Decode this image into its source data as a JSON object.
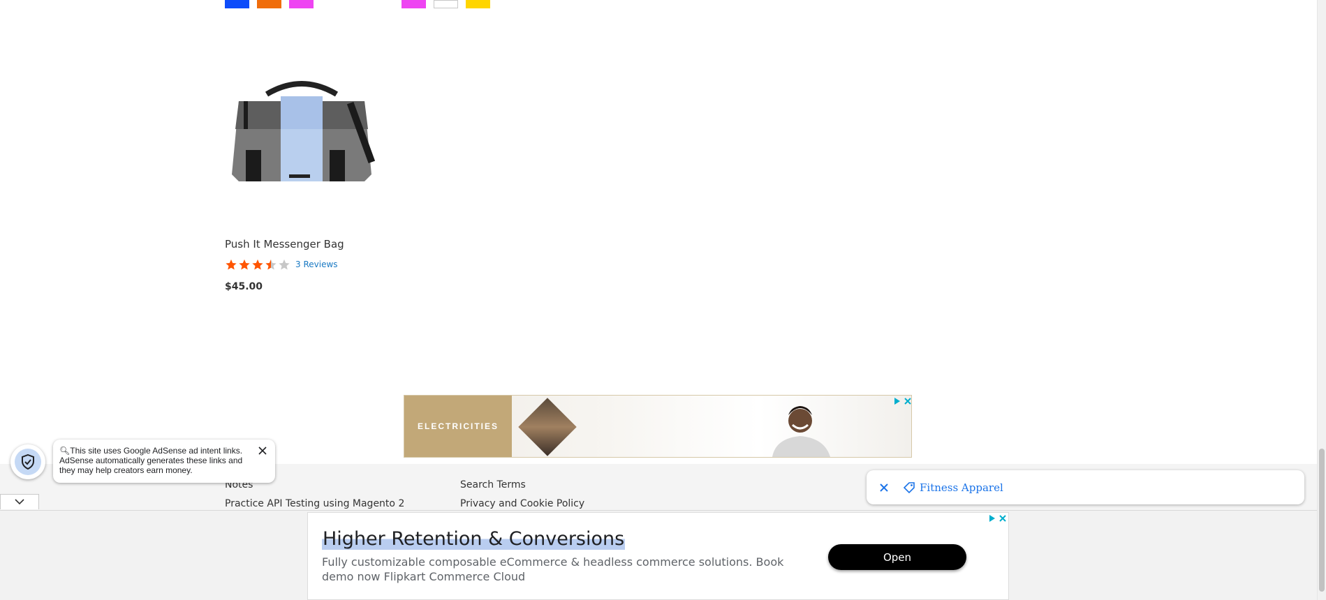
{
  "swatches": {
    "left_group": [
      "#0d4cfa",
      "#f06d0b",
      "#ee44f2"
    ],
    "right_group": [
      "#ee44f2",
      "#ffffff",
      "#ffd500"
    ]
  },
  "product": {
    "name": "Push It Messenger Bag",
    "rating_stars": 3.5,
    "rating_max": 5,
    "reviews_label": "3 Reviews",
    "price": "$45.00",
    "image_icon": "messenger-bag-image"
  },
  "banner_ad": {
    "brand_text": "ELECTRICITIES",
    "brand_color": "#c2a878"
  },
  "footer": {
    "links": [
      "Notes",
      "Practice API Testing using Magento 2",
      "Search Terms",
      "Privacy and Cookie Policy"
    ]
  },
  "adsense_notice": {
    "text": "This site uses Google AdSense ad intent links. AdSense automatically generates these links and they may help creators earn money.",
    "icon": "shield-check-icon"
  },
  "search_chip": {
    "label": "Fitness Apparel",
    "icon": "tag-icon"
  },
  "bottom_ad": {
    "headline": "Higher Retention & Conversions",
    "description": "Fully customizable composable eCommerce & headless commerce solutions. Book demo now Flipkart Commerce Cloud",
    "button_label": "Open"
  },
  "colors": {
    "star_filled": "#ff5501",
    "star_empty": "#c7c7c7",
    "link": "#1979c3",
    "accent_blue": "#1a73e8"
  }
}
